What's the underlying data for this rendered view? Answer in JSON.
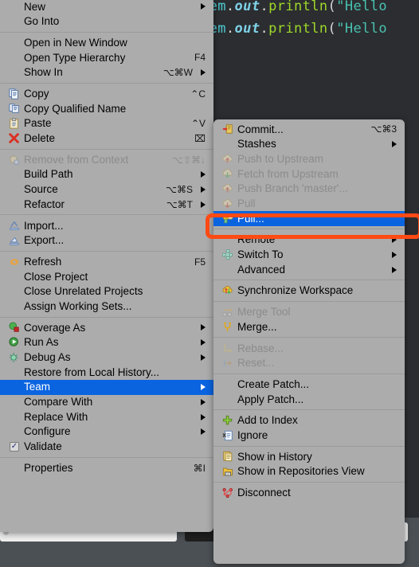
{
  "editor": {
    "lines": [
      {
        "parts": [
          {
            "t": "tem",
            "c": "tk-var"
          },
          {
            "t": ".",
            "c": "tk-dot"
          },
          {
            "t": "out",
            "c": "tk-field"
          },
          {
            "t": ".",
            "c": "tk-dot"
          },
          {
            "t": "println",
            "c": "tk-meth"
          },
          {
            "t": "(",
            "c": "tk-paren"
          },
          {
            "t": "\"Hello",
            "c": "tk-str"
          }
        ]
      },
      {
        "parts": [
          {
            "t": "tem",
            "c": "tk-var"
          },
          {
            "t": ".",
            "c": "tk-dot"
          },
          {
            "t": "out",
            "c": "tk-field"
          },
          {
            "t": ".",
            "c": "tk-dot"
          },
          {
            "t": "println",
            "c": "tk-meth"
          },
          {
            "t": "(",
            "c": "tk-paren"
          },
          {
            "t": "\"Hello",
            "c": "tk-str"
          }
        ]
      }
    ]
  },
  "context_menu": {
    "name": "project-context-menu",
    "groups": [
      {
        "items": [
          {
            "label": "New",
            "icon": "none",
            "shortcut": "",
            "submenu": true,
            "disabled": false,
            "selected": false
          },
          {
            "label": "Go Into",
            "icon": "none",
            "shortcut": "",
            "submenu": false,
            "disabled": false,
            "selected": false
          }
        ]
      },
      {
        "items": [
          {
            "label": "Open in New Window",
            "icon": "none",
            "shortcut": "",
            "submenu": false,
            "disabled": false,
            "selected": false
          },
          {
            "label": "Open Type Hierarchy",
            "icon": "none",
            "shortcut": "F4",
            "submenu": false,
            "disabled": false,
            "selected": false
          },
          {
            "label": "Show In",
            "icon": "none",
            "shortcut": "⌥⌘W",
            "submenu": true,
            "disabled": false,
            "selected": false
          }
        ]
      },
      {
        "items": [
          {
            "label": "Copy",
            "icon": "copy-icon",
            "shortcut": "⌃C",
            "submenu": false,
            "disabled": false,
            "selected": false
          },
          {
            "label": "Copy Qualified Name",
            "icon": "copy-qualified-icon",
            "shortcut": "",
            "submenu": false,
            "disabled": false,
            "selected": false
          },
          {
            "label": "Paste",
            "icon": "paste-icon",
            "shortcut": "⌃V",
            "submenu": false,
            "disabled": false,
            "selected": false
          },
          {
            "label": "Delete",
            "icon": "delete-icon",
            "shortcut": "⌧",
            "submenu": false,
            "disabled": false,
            "selected": false
          }
        ]
      },
      {
        "items": [
          {
            "label": "Remove from Context",
            "icon": "remove-context-icon",
            "shortcut": "⌥⇧⌘↓",
            "submenu": false,
            "disabled": true,
            "selected": false
          },
          {
            "label": "Build Path",
            "icon": "none",
            "shortcut": "",
            "submenu": true,
            "disabled": false,
            "selected": false
          },
          {
            "label": "Source",
            "icon": "none",
            "shortcut": "⌥⌘S",
            "submenu": true,
            "disabled": false,
            "selected": false
          },
          {
            "label": "Refactor",
            "icon": "none",
            "shortcut": "⌥⌘T",
            "submenu": true,
            "disabled": false,
            "selected": false
          }
        ]
      },
      {
        "items": [
          {
            "label": "Import...",
            "icon": "import-icon",
            "shortcut": "",
            "submenu": false,
            "disabled": false,
            "selected": false
          },
          {
            "label": "Export...",
            "icon": "export-icon",
            "shortcut": "",
            "submenu": false,
            "disabled": false,
            "selected": false
          }
        ]
      },
      {
        "items": [
          {
            "label": "Refresh",
            "icon": "refresh-icon",
            "shortcut": "F5",
            "submenu": false,
            "disabled": false,
            "selected": false
          },
          {
            "label": "Close Project",
            "icon": "none",
            "shortcut": "",
            "submenu": false,
            "disabled": false,
            "selected": false
          },
          {
            "label": "Close Unrelated Projects",
            "icon": "none",
            "shortcut": "",
            "submenu": false,
            "disabled": false,
            "selected": false
          },
          {
            "label": "Assign Working Sets...",
            "icon": "none",
            "shortcut": "",
            "submenu": false,
            "disabled": false,
            "selected": false
          }
        ]
      },
      {
        "items": [
          {
            "label": "Coverage As",
            "icon": "coverage-icon",
            "shortcut": "",
            "submenu": true,
            "disabled": false,
            "selected": false
          },
          {
            "label": "Run As",
            "icon": "run-icon",
            "shortcut": "",
            "submenu": true,
            "disabled": false,
            "selected": false
          },
          {
            "label": "Debug As",
            "icon": "debug-icon",
            "shortcut": "",
            "submenu": true,
            "disabled": false,
            "selected": false
          },
          {
            "label": "Restore from Local History...",
            "icon": "none",
            "shortcut": "",
            "submenu": false,
            "disabled": false,
            "selected": false
          },
          {
            "label": "Team",
            "icon": "none",
            "shortcut": "",
            "submenu": true,
            "disabled": false,
            "selected": true
          },
          {
            "label": "Compare With",
            "icon": "none",
            "shortcut": "",
            "submenu": true,
            "disabled": false,
            "selected": false
          },
          {
            "label": "Replace With",
            "icon": "none",
            "shortcut": "",
            "submenu": true,
            "disabled": false,
            "selected": false
          },
          {
            "label": "Configure",
            "icon": "none",
            "shortcut": "",
            "submenu": true,
            "disabled": false,
            "selected": false
          },
          {
            "label": "Validate",
            "icon": "checkbox-checked-icon",
            "shortcut": "",
            "submenu": false,
            "disabled": false,
            "selected": false
          }
        ]
      },
      {
        "items": [
          {
            "label": "Properties",
            "icon": "none",
            "shortcut": "⌘I",
            "submenu": false,
            "disabled": false,
            "selected": false
          }
        ]
      }
    ]
  },
  "team_submenu": {
    "name": "team-submenu",
    "groups": [
      {
        "items": [
          {
            "label": "Commit...",
            "icon": "commit-icon",
            "shortcut": "⌥⌘3",
            "submenu": false,
            "disabled": false,
            "selected": false
          },
          {
            "label": "Stashes",
            "icon": "none",
            "shortcut": "",
            "submenu": true,
            "disabled": false,
            "selected": false
          },
          {
            "label": "Push to Upstream",
            "icon": "push-icon",
            "shortcut": "",
            "submenu": false,
            "disabled": true,
            "selected": false
          },
          {
            "label": "Fetch from Upstream",
            "icon": "fetch-icon",
            "shortcut": "",
            "submenu": false,
            "disabled": true,
            "selected": false
          },
          {
            "label": "Push Branch 'master'...",
            "icon": "push-branch-icon",
            "shortcut": "",
            "submenu": false,
            "disabled": true,
            "selected": false
          },
          {
            "label": "Pull",
            "icon": "pull-icon",
            "shortcut": "",
            "submenu": false,
            "disabled": true,
            "selected": false
          },
          {
            "label": "Pull...",
            "icon": "pull-config-icon",
            "shortcut": "",
            "submenu": false,
            "disabled": false,
            "selected": true
          }
        ]
      },
      {
        "items": [
          {
            "label": "Remote",
            "icon": "none",
            "shortcut": "",
            "submenu": true,
            "disabled": false,
            "selected": false
          },
          {
            "label": "Switch To",
            "icon": "switch-to-icon",
            "shortcut": "",
            "submenu": true,
            "disabled": false,
            "selected": false
          },
          {
            "label": "Advanced",
            "icon": "none",
            "shortcut": "",
            "submenu": true,
            "disabled": false,
            "selected": false
          }
        ]
      },
      {
        "items": [
          {
            "label": "Synchronize Workspace",
            "icon": "synchronize-icon",
            "shortcut": "",
            "submenu": false,
            "disabled": false,
            "selected": false
          }
        ]
      },
      {
        "items": [
          {
            "label": "Merge Tool",
            "icon": "merge-tool-icon",
            "shortcut": "",
            "submenu": false,
            "disabled": true,
            "selected": false
          },
          {
            "label": "Merge...",
            "icon": "merge-icon",
            "shortcut": "",
            "submenu": false,
            "disabled": false,
            "selected": false
          }
        ]
      },
      {
        "items": [
          {
            "label": "Rebase...",
            "icon": "rebase-icon",
            "shortcut": "",
            "submenu": false,
            "disabled": true,
            "selected": false
          },
          {
            "label": "Reset...",
            "icon": "reset-icon",
            "shortcut": "",
            "submenu": false,
            "disabled": true,
            "selected": false
          }
        ]
      },
      {
        "items": [
          {
            "label": "Create Patch...",
            "icon": "none",
            "shortcut": "",
            "submenu": false,
            "disabled": false,
            "selected": false
          },
          {
            "label": "Apply Patch...",
            "icon": "none",
            "shortcut": "",
            "submenu": false,
            "disabled": false,
            "selected": false
          }
        ]
      },
      {
        "items": [
          {
            "label": "Add to Index",
            "icon": "add-to-index-icon",
            "shortcut": "",
            "submenu": false,
            "disabled": false,
            "selected": false
          },
          {
            "label": "Ignore",
            "icon": "ignore-icon",
            "shortcut": "",
            "submenu": false,
            "disabled": false,
            "selected": false
          }
        ]
      },
      {
        "items": [
          {
            "label": "Show in History",
            "icon": "history-icon",
            "shortcut": "",
            "submenu": false,
            "disabled": false,
            "selected": false
          },
          {
            "label": "Show in Repositories View",
            "icon": "repositories-icon",
            "shortcut": "",
            "submenu": false,
            "disabled": false,
            "selected": false
          }
        ]
      },
      {
        "items": [
          {
            "label": "Disconnect",
            "icon": "disconnect-icon",
            "shortcut": "",
            "submenu": false,
            "disabled": false,
            "selected": false
          }
        ]
      }
    ]
  },
  "annotation": {
    "name": "pull-highlight-box",
    "color": "#ff4a14",
    "target": "Pull..."
  },
  "colors": {
    "menu_background": "#acacac",
    "selection_blue": "#0a64e0",
    "disabled_text": "#8b8b8b",
    "editor_background": "#2b2d30",
    "annotation_orange": "#ff4a14"
  }
}
